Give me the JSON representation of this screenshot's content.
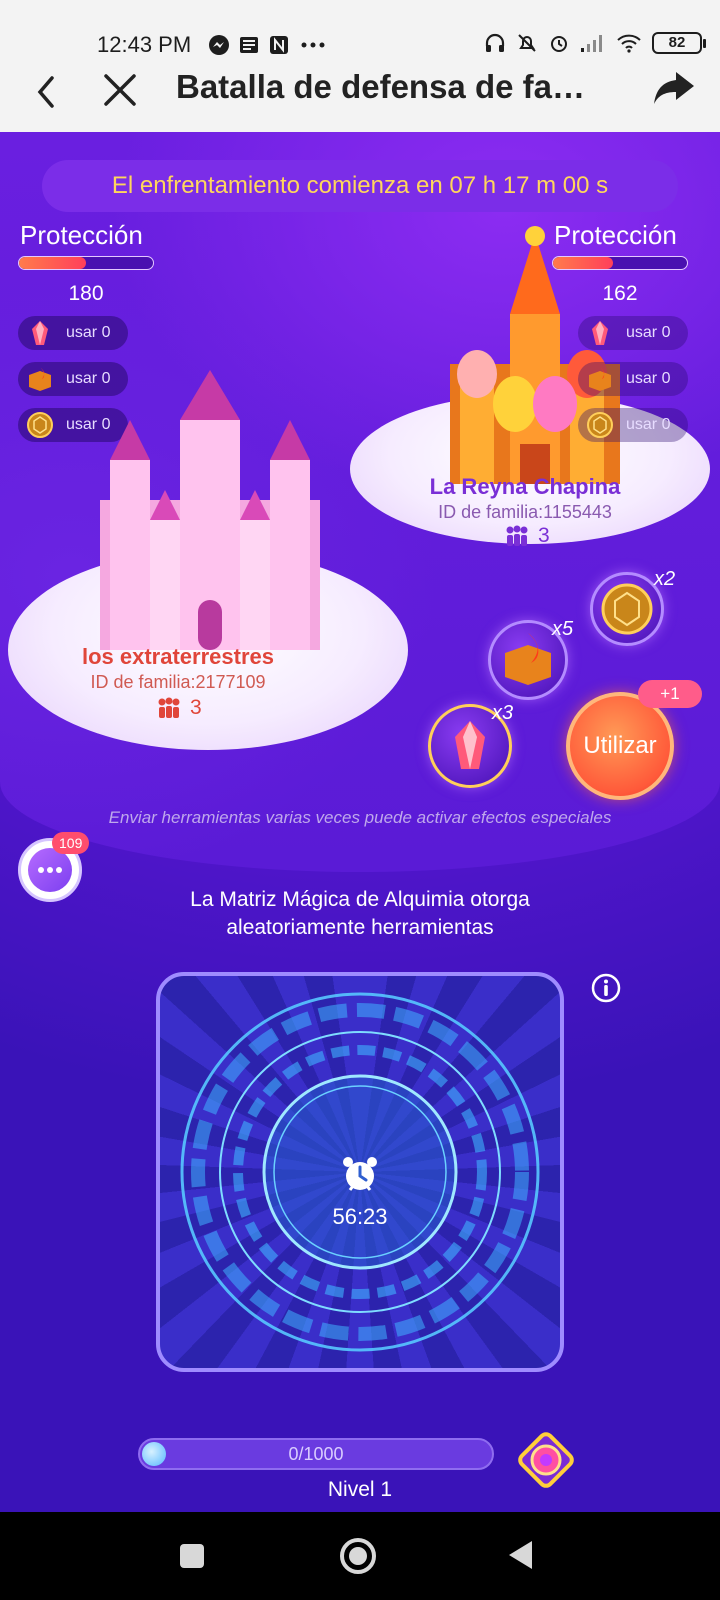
{
  "status_bar": {
    "time": "12:43 PM",
    "battery": "82"
  },
  "nav": {
    "title": "Batalla de defensa de fa…"
  },
  "banner": {
    "text": "El enfrentamiento comienza en 07 h 17 m 00 s"
  },
  "left_family": {
    "protection_label": "Protección",
    "protection_value": "180",
    "protection_fraction": 0.5,
    "name": "los extraterrestres",
    "family_id": "ID de familia:2177109",
    "members": "3",
    "items": [
      {
        "label": "usar",
        "count": "0",
        "icon": "crystal-icon"
      },
      {
        "label": "usar",
        "count": "0",
        "icon": "fire-book-icon"
      },
      {
        "label": "usar",
        "count": "0",
        "icon": "shield-ball-icon"
      }
    ]
  },
  "right_family": {
    "protection_label": "Protección",
    "protection_value": "162",
    "protection_fraction": 0.45,
    "name": "La Reyna Chapina",
    "family_id": "ID de familia:1155443",
    "members": "3",
    "items": [
      {
        "label": "usar",
        "count": "0",
        "icon": "crystal-icon"
      },
      {
        "label": "usar",
        "count": "0",
        "icon": "fire-book-icon"
      },
      {
        "label": "usar",
        "count": "0",
        "icon": "shield-ball-icon"
      }
    ]
  },
  "tools": {
    "crystal_mult": "x3",
    "book_mult": "x5",
    "shield_mult": "x2",
    "use_button": "Utilizar",
    "plus_badge": "+1"
  },
  "hint": "Enviar herramientas varias veces puede activar efectos especiales",
  "chat": {
    "badge": "109"
  },
  "matrix": {
    "title_line1": "La Matriz Mágica de Alquimia otorga",
    "title_line2": "aleatoriamente herramientas",
    "timer": "56:23"
  },
  "progress": {
    "text": "0/1000",
    "level": "Nivel 1",
    "fraction": 0
  },
  "colors": {
    "accent_orange": "#ff5a3a",
    "banner_text": "#ffd65c",
    "left_name": "#e0463a",
    "right_name": "#7a2fd6"
  }
}
